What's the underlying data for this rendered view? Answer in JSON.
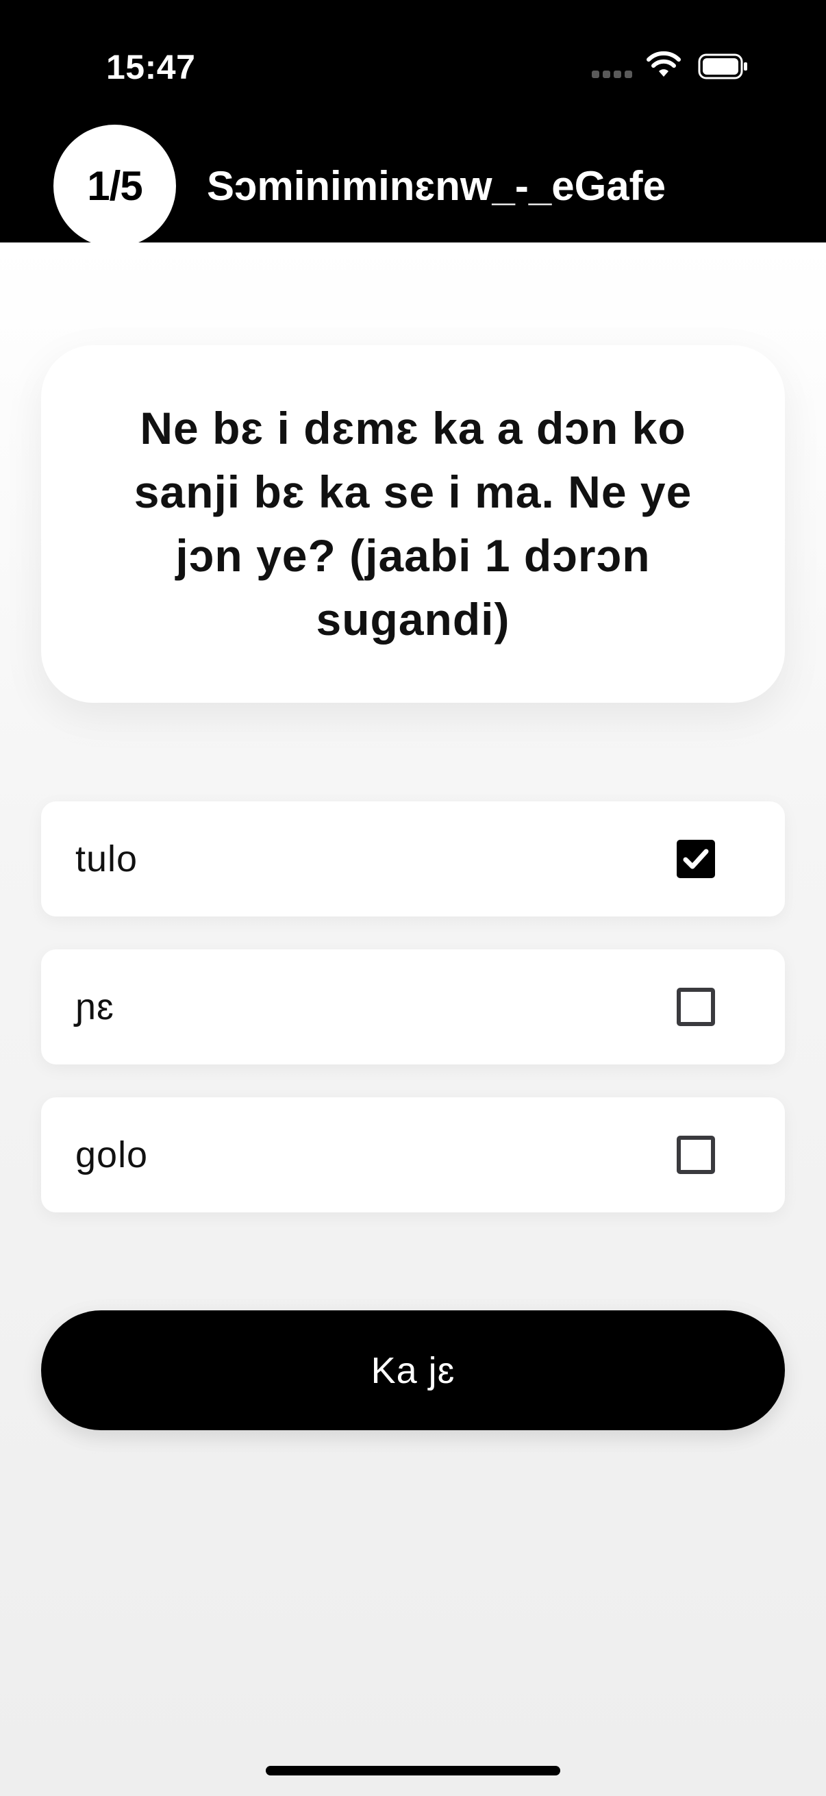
{
  "status_bar": {
    "time": "15:47",
    "icons": [
      "cellular-signal-icon",
      "wifi-icon",
      "battery-icon"
    ]
  },
  "header": {
    "step": "1/5",
    "title": "Sɔminiminɛnw_-_eGafe",
    "background_color": "#000000"
  },
  "question": {
    "text": "Ne bɛ i dɛmɛ ka a dɔn ko sanji bɛ ka se i ma. Ne ye jɔn ye? (jaabi 1 dɔrɔn sugandi)"
  },
  "options": [
    {
      "label": "tulo",
      "checked": true
    },
    {
      "label": "ɲɛ",
      "checked": false
    },
    {
      "label": "golo",
      "checked": false
    }
  ],
  "submit": {
    "label": "Ka jɛ"
  }
}
